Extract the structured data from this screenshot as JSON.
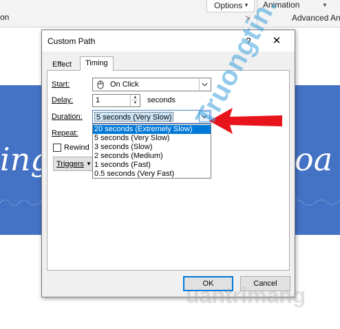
{
  "ribbon": {
    "left_text": "on",
    "options_label": "Options",
    "animation_label": "Animation",
    "advanced_label": "Advanced Ani"
  },
  "slide": {
    "text_left": "ing",
    "text_right": "oa"
  },
  "dialog": {
    "title": "Custom Path",
    "help_label": "?",
    "close_label": "✕",
    "tabs": [
      {
        "label": "Effect",
        "active": false
      },
      {
        "label": "Timing",
        "active": true
      }
    ],
    "start": {
      "label": "Start:",
      "value": "On Click"
    },
    "delay": {
      "label": "Delay:",
      "value": "1",
      "unit": "seconds"
    },
    "duration": {
      "label": "Duration:",
      "value": "5 seconds (Very Slow)",
      "options": [
        "20 seconds (Extremely Slow)",
        "5 seconds (Very Slow)",
        "3 seconds (Slow)",
        "2 seconds (Medium)",
        "1 seconds (Fast)",
        "0.5 seconds (Very Fast)"
      ],
      "highlighted_index": 0
    },
    "repeat": {
      "label": "Repeat:"
    },
    "rewind": {
      "label": "Rewind",
      "checked": false
    },
    "triggers": {
      "label": "Triggers"
    },
    "ok_label": "OK",
    "cancel_label": "Cancel"
  },
  "watermark": {
    "diagonal": "Truongtin.top",
    "bottom": "uantrimang"
  },
  "colors": {
    "slide_band": "#4472c4",
    "selection": "#0078d7",
    "annotation_arrow": "#e8141b",
    "watermark": "#3ca0dc"
  }
}
